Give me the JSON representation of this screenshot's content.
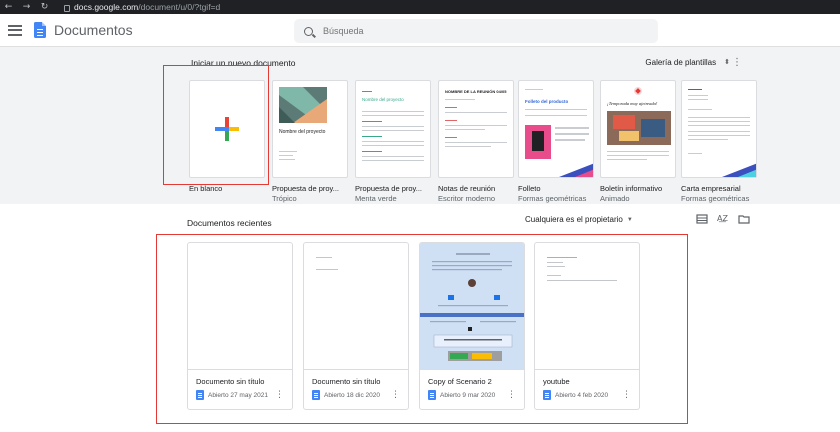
{
  "browser": {
    "url_domain": "docs.google.com",
    "url_path": "/document/u/0/?tgif=d"
  },
  "appbar": {
    "title": "Documentos",
    "search_placeholder": "Búsqueda"
  },
  "templates": {
    "heading": "Iniciar un nuevo documento",
    "gallery_label": "Galería de plantillas",
    "items": [
      {
        "name": "En blanco",
        "subtitle": ""
      },
      {
        "name": "Propuesta de proy...",
        "subtitle": "Trópico",
        "thumb_title": "Nombre del proyecto"
      },
      {
        "name": "Propuesta de proy...",
        "subtitle": "Menta verde",
        "thumb_title": "Nombre del proyecto"
      },
      {
        "name": "Notas de reunión",
        "subtitle": "Escritor moderno",
        "thumb_title": "NOMBRE DE LA REUNIÓN 04/05"
      },
      {
        "name": "Folleto",
        "subtitle": "Formas geométricas",
        "thumb_title": "Folleto del producto"
      },
      {
        "name": "Boletín informativo",
        "subtitle": "Animado",
        "thumb_title": "¡Temporada muy ajetreada!"
      },
      {
        "name": "Carta empresarial",
        "subtitle": "Formas geométricas",
        "thumb_title": ""
      }
    ]
  },
  "recent": {
    "heading": "Documentos recientes",
    "owner_filter": "Cualquiera es el propietario",
    "docs": [
      {
        "name": "Documento sin título",
        "opened": "Abierto 27 may 2021"
      },
      {
        "name": "Documento sin título",
        "opened": "Abierto 18 dic 2020"
      },
      {
        "name": "Copy of Scenario 2",
        "opened": "Abierto 9 mar 2020"
      },
      {
        "name": "youtube",
        "opened": "Abierto 4 feb 2020"
      }
    ]
  },
  "colors": {
    "accent_blue": "#4285f4",
    "highlight_red": "#e53935",
    "chrome_dark": "#202124"
  }
}
